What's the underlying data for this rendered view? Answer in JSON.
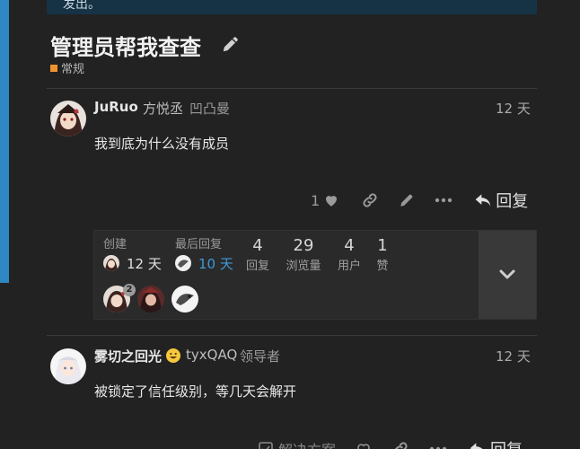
{
  "banner": {
    "text": "发出。"
  },
  "topic": {
    "title": "管理员帮我查查",
    "category": "常规",
    "category_color": "#f1932d"
  },
  "post1": {
    "username": "JuRuo",
    "full_name": "方悦丞",
    "flair": "凹凸曼",
    "date": "12 天",
    "body": "我到底为什么没有成员",
    "like_count": "1",
    "reply_label": "回复"
  },
  "meta": {
    "created_label": "创建",
    "created_value": "12 天",
    "last_reply_label": "最后回复",
    "last_reply_value": "10 天",
    "replies_num": "4",
    "replies_label": "回复",
    "views_num": "29",
    "views_label": "浏览量",
    "users_num": "4",
    "users_label": "用户",
    "likes_num": "1",
    "likes_label": "赞",
    "participant_badge": "2"
  },
  "post2": {
    "username": "雾切之回光",
    "full_name": "tyxQAQ",
    "flair": "领导者",
    "date": "12 天",
    "body": "被锁定了信任级别，等几天会解开",
    "solution_label": "解决方案",
    "reply_label": "回复"
  },
  "colors": {
    "accent_blue": "#2f87c4",
    "link_blue": "#3d9ad6",
    "background": "#222222"
  }
}
